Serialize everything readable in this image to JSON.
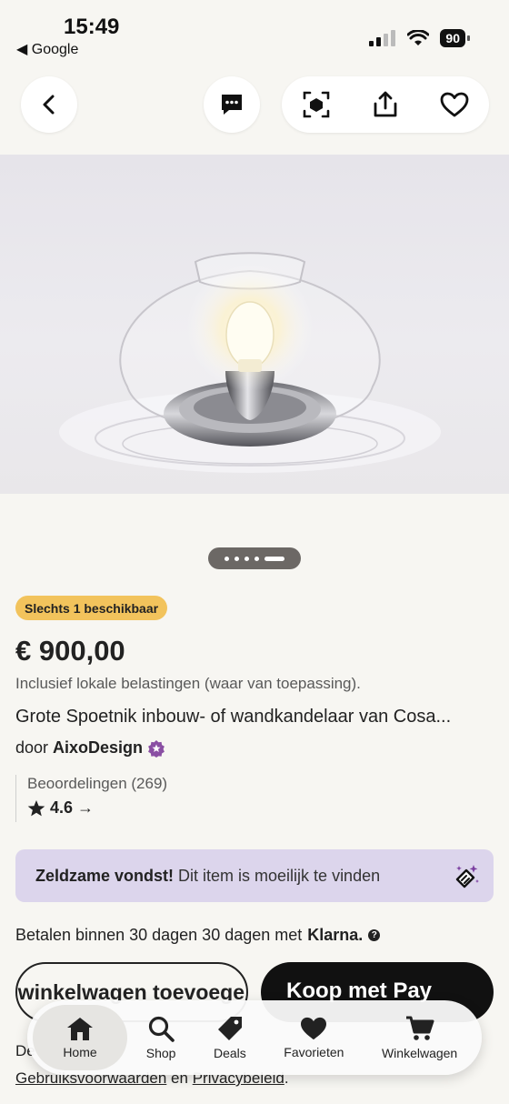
{
  "status": {
    "time": "15:49",
    "back_app": "◀ Google",
    "battery": "90"
  },
  "nav": {
    "back_icon": "chevron-left-icon",
    "message_icon": "message-icon",
    "ar_icon": "ar-cube-icon",
    "share_icon": "share-icon",
    "favorite_icon": "heart-icon"
  },
  "product": {
    "badge": "Slechts 1 beschikbaar",
    "price": "€ 900,00",
    "tax_note": "Inclusief lokale belastingen (waar van toepassing).",
    "title": "Grote Spoetnik inbouw- of wandkandelaar van Cosa...",
    "seller_prefix": "door",
    "seller_name": "AixoDesign",
    "reviews_label": "Beoordelingen (269)",
    "rating": "4.6 →"
  },
  "pager": {
    "count": 5,
    "active_index": 4
  },
  "rare": {
    "title": "Zeldzame vondst!",
    "text": "Dit item is moeilijk te vinden"
  },
  "payment": {
    "klarna_text": "Betalen binnen 30 dagen 30 dagen met",
    "klarna_brand": "Klarna.",
    "help": "?"
  },
  "buttons": {
    "add_to_cart": "an winkelwagen toevoege",
    "buy_with": "Koop met  Pay"
  },
  "footer": {
    "line1": "De",
    "terms": "Gebruiksvoorwaarden",
    "and": "en",
    "privacy": "Privacybeleid",
    "end": "."
  },
  "tabbar": [
    {
      "label": "Home",
      "icon": "home-icon"
    },
    {
      "label": "Shop",
      "icon": "search-icon"
    },
    {
      "label": "Deals",
      "icon": "tag-icon"
    },
    {
      "label": "Favorieten",
      "icon": "heart-icon"
    },
    {
      "label": "Winkelwagen",
      "icon": "cart-icon"
    }
  ],
  "colors": {
    "background": "#f7f6f2",
    "badge": "#f2c35c",
    "rare_box": "#dcd5ec",
    "star_badge": "#8a4fa3",
    "pay_button": "#111111"
  }
}
